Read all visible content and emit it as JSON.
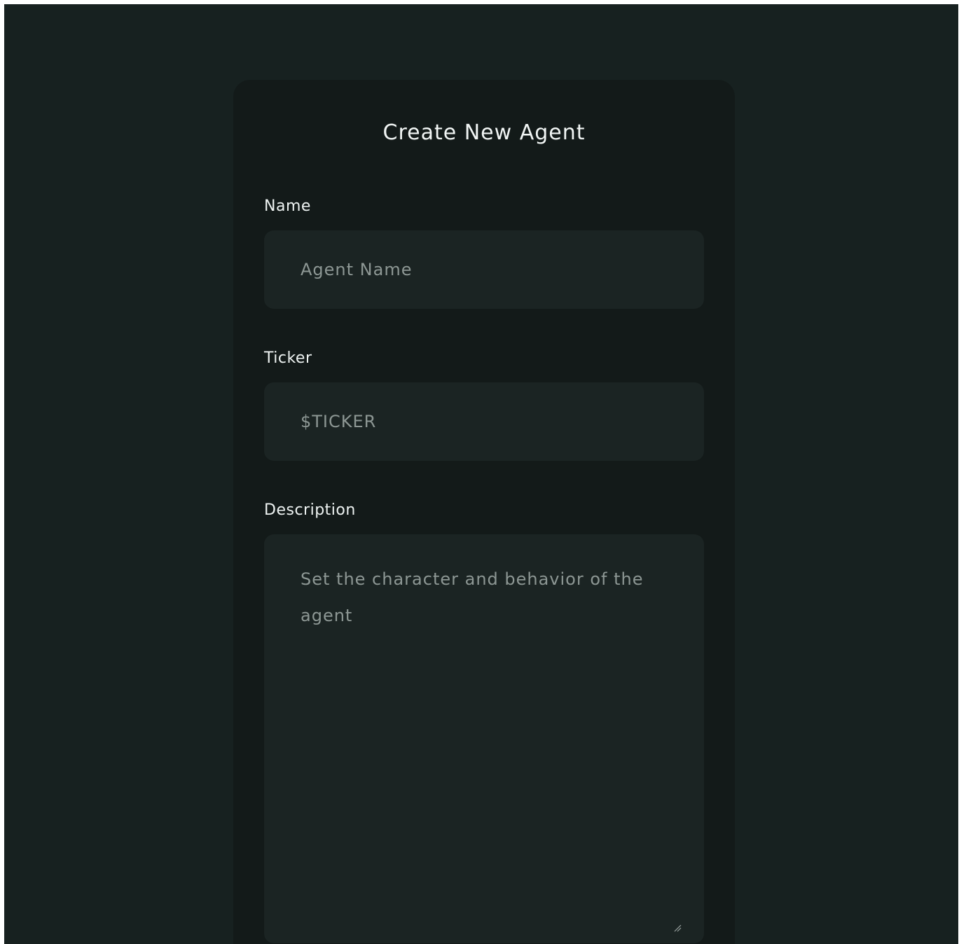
{
  "form": {
    "title": "Create New Agent",
    "name": {
      "label": "Name",
      "placeholder": "Agent Name",
      "value": ""
    },
    "ticker": {
      "label": "Ticker",
      "placeholder": "$TICKER",
      "value": ""
    },
    "description": {
      "label": "Description",
      "placeholder": "Set the character and behavior of the agent",
      "value": ""
    }
  },
  "icons": {
    "resize_grip": "resize-grip-icon"
  },
  "colors": {
    "page_background": "#172120",
    "card_background": "#131a19",
    "input_background": "#1b2423",
    "text_primary": "#f1f5f4",
    "placeholder": "#8d9794"
  }
}
